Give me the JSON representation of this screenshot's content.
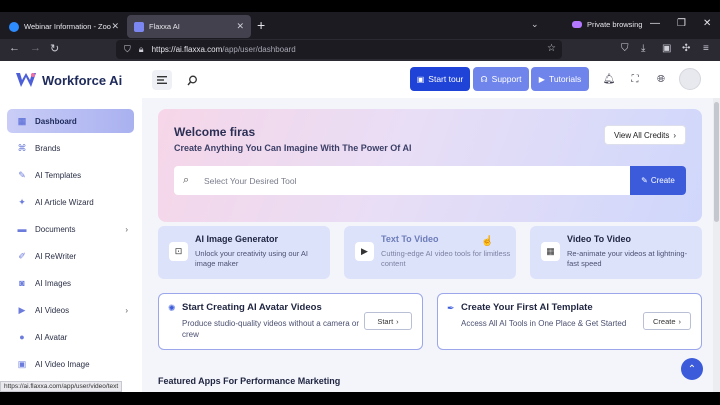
{
  "browser": {
    "tabs": [
      {
        "title": "Webinar Information - Zoom",
        "active": false
      },
      {
        "title": "Flaxxa AI",
        "active": true
      }
    ],
    "private_label": "Private browsing",
    "url_host": "https://ai.flaxxa.com",
    "url_path": "/app/user/dashboard",
    "status_url": "https://ai.flaxxa.com/app/user/video/text"
  },
  "app": {
    "brand": "Workforce Ai",
    "buttons": {
      "start_tour": "Start tour",
      "support": "Support",
      "tutorials": "Tutorials"
    },
    "accent_color": "#3b5bdb"
  },
  "sidebar": {
    "items": [
      {
        "label": "Dashboard",
        "icon": "dashboard-icon",
        "active": true
      },
      {
        "label": "Brands",
        "icon": "brands-icon"
      },
      {
        "label": "AI Templates",
        "icon": "templates-icon"
      },
      {
        "label": "AI Article Wizard",
        "icon": "wizard-icon"
      },
      {
        "label": "Documents",
        "icon": "folder-icon",
        "has_submenu": true
      },
      {
        "label": "AI ReWriter",
        "icon": "rewriter-icon"
      },
      {
        "label": "AI Images",
        "icon": "image-icon"
      },
      {
        "label": "AI Videos",
        "icon": "video-icon",
        "has_submenu": true
      },
      {
        "label": "AI Avatar",
        "icon": "avatar-icon"
      },
      {
        "label": "AI Video Image",
        "icon": "video-image-icon"
      }
    ]
  },
  "welcome": {
    "title": "Welcome firas",
    "subtitle": "Create Anything You Can Imagine With The Power Of AI",
    "credits_button": "View All Credits",
    "search_placeholder": "Select Your Desired Tool",
    "create_button": "Create"
  },
  "tools": [
    {
      "title": "AI Image Generator",
      "desc": "Unlock your creativity using our AI image maker"
    },
    {
      "title": "Text To Video",
      "desc": "Cutting-edge AI video tools for limitless content"
    },
    {
      "title": "Video To Video",
      "desc": "Re-animate your videos at lightning-fast speed"
    }
  ],
  "actions": [
    {
      "title": "Start Creating AI Avatar Videos",
      "desc": "Produce studio-quality videos without a camera or crew",
      "button": "Start"
    },
    {
      "title": "Create Your First AI Template",
      "desc": "Access All AI Tools in One Place & Get Started",
      "button": "Create"
    }
  ],
  "featured_heading": "Featured Apps For Performance Marketing"
}
